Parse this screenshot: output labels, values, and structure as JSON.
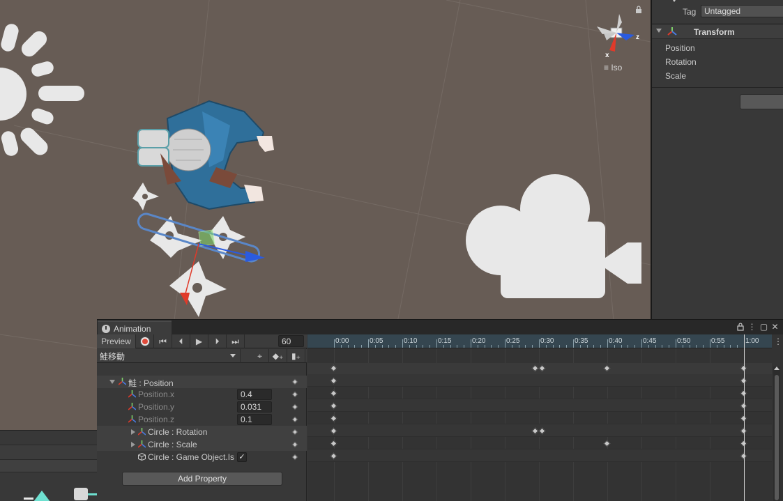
{
  "scene": {
    "gizmo_axes": {
      "x": "x",
      "z": "z"
    },
    "projection_label": "Iso"
  },
  "inspector": {
    "tag_label": "Tag",
    "tag_value": "Untagged",
    "transform_title": "Transform",
    "properties": [
      "Position",
      "Rotation",
      "Scale"
    ]
  },
  "animation": {
    "tab_title": "Animation",
    "toolbar": {
      "preview_label": "Preview",
      "frame_value": "60"
    },
    "clip_name": "鮭移動",
    "properties": [
      {
        "label": "鮭 : Position",
        "type": "group-open"
      },
      {
        "label": "Position.x",
        "value": "0.4",
        "type": "child"
      },
      {
        "label": "Position.y",
        "value": "0.031",
        "type": "child"
      },
      {
        "label": "Position.z",
        "value": "0.1",
        "type": "child"
      },
      {
        "label": "Circle : Rotation",
        "type": "group-closed"
      },
      {
        "label": "Circle : Scale",
        "type": "group-closed"
      },
      {
        "label": "Circle : Game Object.Is",
        "type": "toggle",
        "checked": true
      }
    ],
    "add_property_label": "Add Property",
    "timeline": {
      "tick_labels": [
        "0:00",
        "0:05",
        "0:10",
        "0:15",
        "0:20",
        "0:25",
        "0:30",
        "0:35",
        "0:40",
        "0:45",
        "0:50",
        "0:55",
        "1:00"
      ],
      "playhead_time": "1:00",
      "keyframes_seconds": {
        "summary": [
          0,
          29.5,
          30.5,
          40,
          60
        ],
        "position_group": [
          0,
          60
        ],
        "position_x": [
          0,
          60
        ],
        "position_y": [
          0,
          60
        ],
        "position_z": [
          0,
          60
        ],
        "circle_rotation": [
          0,
          29.5,
          30.5,
          60
        ],
        "circle_scale": [
          0,
          40,
          60
        ],
        "circle_gameobject": [
          0,
          60
        ]
      }
    }
  },
  "colors": {
    "scene_bg": "#675c55",
    "record_red": "#e04a3a",
    "ruler_bg": "#354650",
    "axis_x": "#e03a2a",
    "axis_z": "#2a5be0"
  }
}
